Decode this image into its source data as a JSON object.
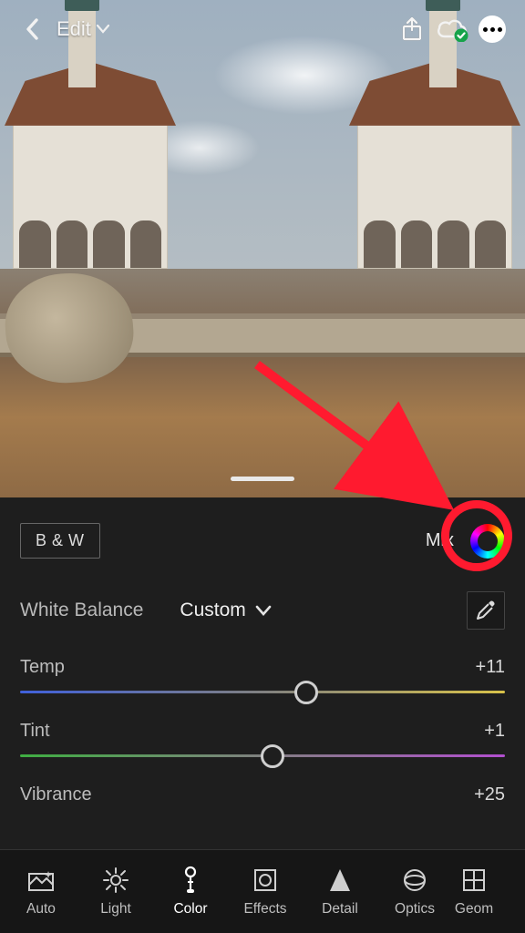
{
  "header": {
    "title": "Edit"
  },
  "panel": {
    "bw_label": "B & W",
    "mix_label": "Mix",
    "wb_label": "White Balance",
    "wb_value": "Custom",
    "sliders": {
      "temp": {
        "label": "Temp",
        "value": "+11",
        "thumb_pct": 59
      },
      "tint": {
        "label": "Tint",
        "value": "+1",
        "thumb_pct": 52
      },
      "vibrance": {
        "label": "Vibrance",
        "value": "+25"
      }
    }
  },
  "toolbar": {
    "items": [
      {
        "id": "auto",
        "label": "Auto"
      },
      {
        "id": "light",
        "label": "Light"
      },
      {
        "id": "color",
        "label": "Color"
      },
      {
        "id": "effects",
        "label": "Effects"
      },
      {
        "id": "detail",
        "label": "Detail"
      },
      {
        "id": "optics",
        "label": "Optics"
      },
      {
        "id": "geom",
        "label": "Geom"
      }
    ],
    "active": "color"
  }
}
